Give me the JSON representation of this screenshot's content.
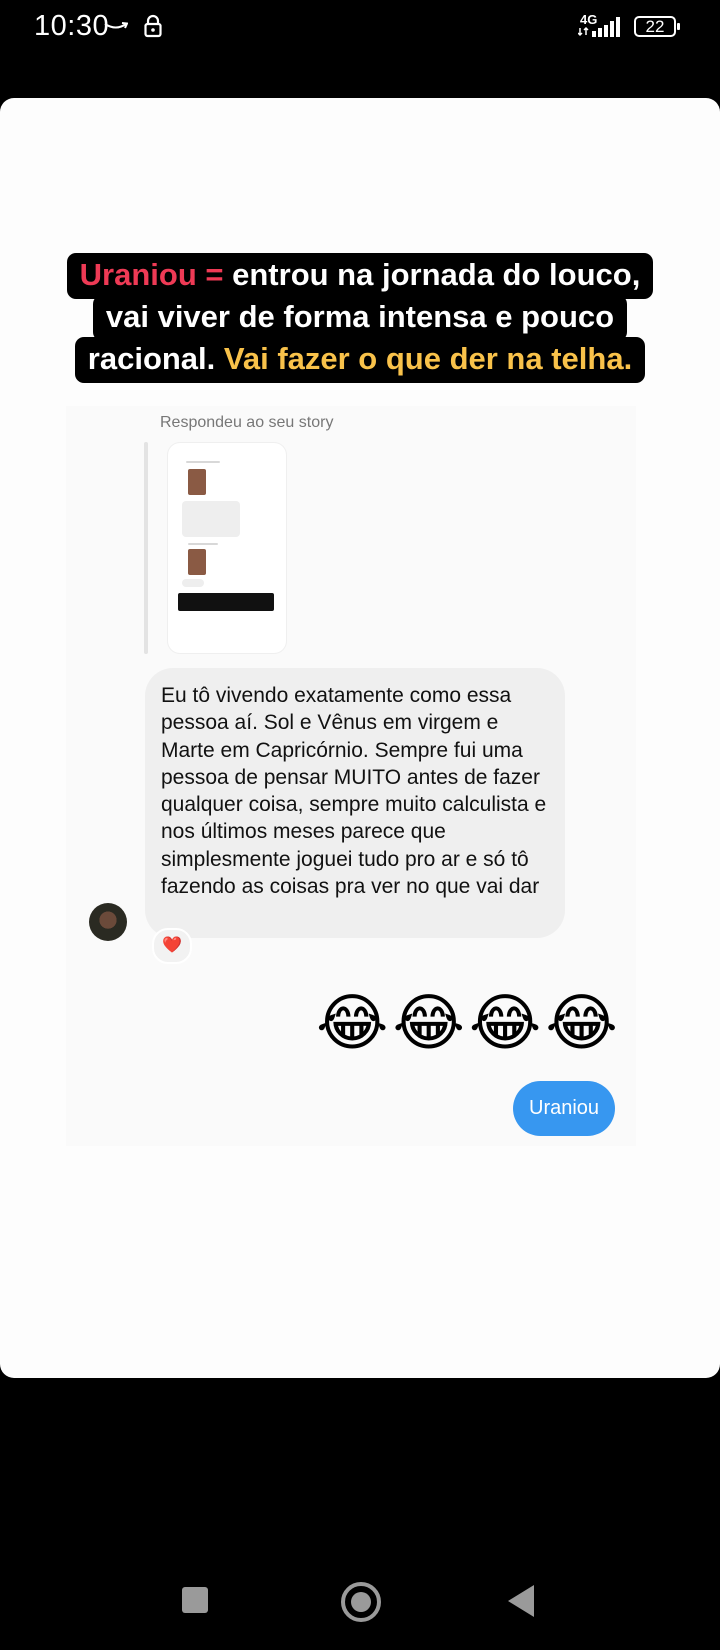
{
  "status_bar": {
    "time": "10:30",
    "network": "4G",
    "battery": "22"
  },
  "story": {
    "caption_lines": [
      {
        "red": "Uraniou =",
        "white": " entrou na jornada do louco,",
        "yellow": ""
      },
      {
        "red": "",
        "white": "vai viver de forma intensa e pouco",
        "yellow": ""
      },
      {
        "red": "",
        "white": "racional. ",
        "yellow": "Vai fazer o que der na telha."
      }
    ]
  },
  "chat": {
    "replied_label": "Respondeu ao seu story",
    "received_message": "Eu tô vivendo exatamente como essa pessoa aí. Sol e Vênus em virgem e Marte em Capricórnio. Sempre fui uma pessoa de pensar MUITO antes de fazer qualquer coisa, sempre muito calculista e nos últimos meses parece que simplesmente joguei tudo pro ar e só tô fazendo as coisas pra ver no que vai dar",
    "reaction": "❤️",
    "emojis": "😂😂😂😂",
    "sent_message": "Uraniou"
  },
  "colors": {
    "accent_red": "#ee3a55",
    "accent_yellow": "#f9c24a",
    "sent_bubble": "#3797f0",
    "received_bubble": "#efefef"
  },
  "icons": [
    "amazon-icon",
    "lock-icon",
    "signal-icon",
    "battery-icon",
    "heart-reaction-icon",
    "recents-icon",
    "home-icon",
    "back-icon"
  ]
}
